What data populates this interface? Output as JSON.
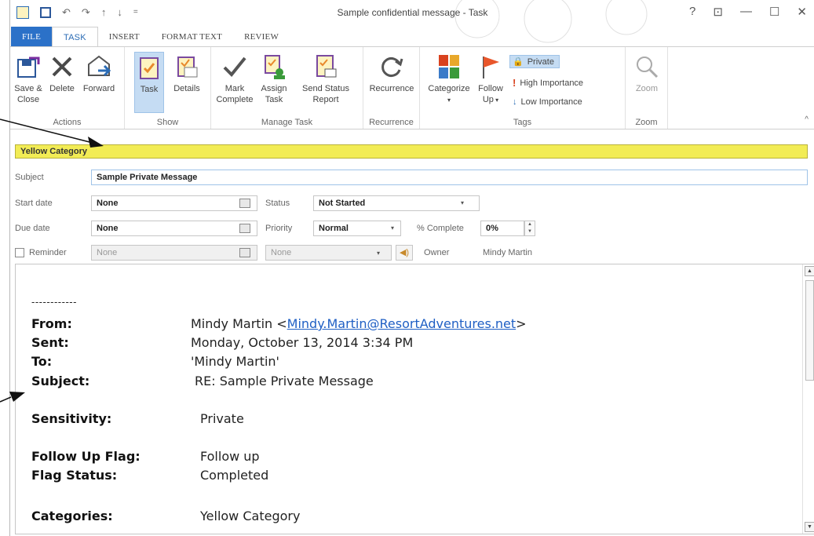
{
  "window": {
    "title": "Sample confidential message - Task",
    "help": "?",
    "restore_ribbon": "⊡",
    "minimize": "—",
    "maximize": "☐",
    "close": "✕"
  },
  "tabs": [
    {
      "label": "FILE"
    },
    {
      "label": "TASK"
    },
    {
      "label": "INSERT"
    },
    {
      "label": "FORMAT TEXT"
    },
    {
      "label": "REVIEW"
    }
  ],
  "ribbon": {
    "actions": {
      "label": "Actions",
      "save_close_1": "Save &",
      "save_close_2": "Close",
      "delete": "Delete",
      "forward": "Forward"
    },
    "show": {
      "label": "Show",
      "task": "Task",
      "details": "Details"
    },
    "manage": {
      "label": "Manage Task",
      "mark_1": "Mark",
      "mark_2": "Complete",
      "assign_1": "Assign",
      "assign_2": "Task",
      "status_1": "Send Status",
      "status_2": "Report"
    },
    "recurrence": {
      "label": "Recurrence",
      "button": "Recurrence"
    },
    "tags": {
      "label": "Tags",
      "categorize": "Categorize",
      "follow_1": "Follow",
      "follow_2": "Up",
      "private": "Private",
      "high": "High Importance",
      "low": "Low Importance"
    },
    "zoom": {
      "label": "Zoom",
      "button": "Zoom"
    }
  },
  "form": {
    "category_banner": "Yellow Category",
    "subject_label": "Subject",
    "subject_value": "Sample Private Message",
    "start_label": "Start date",
    "start_value": "None",
    "due_label": "Due date",
    "due_value": "None",
    "reminder_label": "Reminder",
    "reminder_date": "None",
    "reminder_time": "None",
    "status_label": "Status",
    "status_value": "Not Started",
    "priority_label": "Priority",
    "priority_value": "Normal",
    "complete_label": "% Complete",
    "complete_value": "0%",
    "owner_label": "Owner",
    "owner_value": "Mindy Martin"
  },
  "message": {
    "separator": "------------",
    "from_label": "From:",
    "from_name": "Mindy Martin <",
    "from_email": "Mindy.Martin@ResortAdventures.net",
    "from_close": ">",
    "sent_label": "Sent:",
    "sent_value": "Monday, October 13, 2014 3:34 PM",
    "to_label": "To:",
    "to_value": "'Mindy Martin'",
    "subject_label": "Subject:",
    "subject_value": "RE: Sample Private Message",
    "sensitivity_label": "Sensitivity:",
    "sensitivity_value": "Private",
    "follow_label": "Follow Up Flag:",
    "follow_value": "Follow up",
    "flag_status_label": "Flag Status:",
    "flag_status_value": "Completed",
    "categories_label": "Categories:",
    "categories_value": "Yellow Category"
  },
  "colors": {
    "accent": "#2b71c8",
    "category_yellow": "#f2ec55",
    "link": "#1f5fc4"
  }
}
